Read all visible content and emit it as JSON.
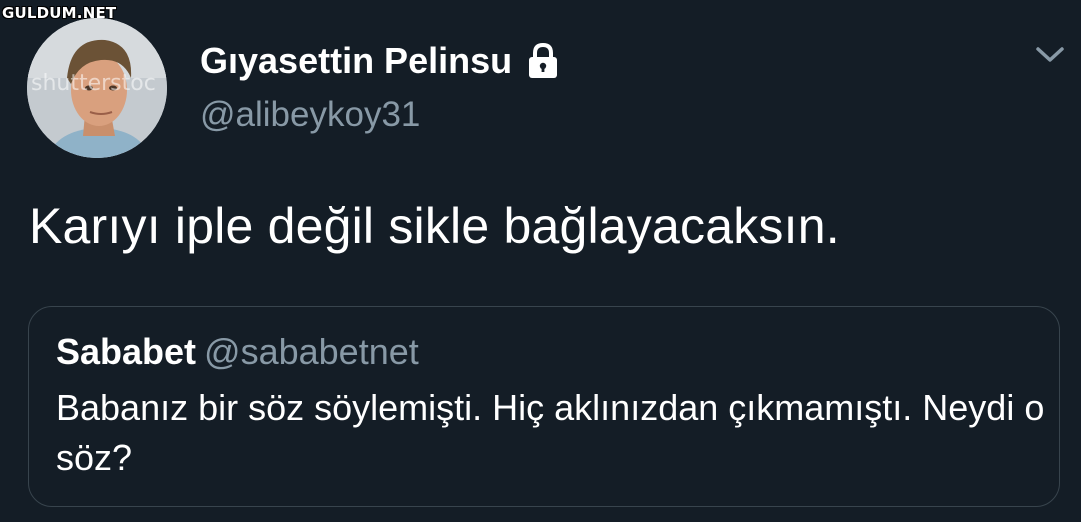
{
  "watermark": "GULDUM.NET",
  "tweet": {
    "author_name": "Gıyasettin Pelinsu",
    "author_handle": "@alibeykoy31",
    "text": "Karıyı iple değil sikle bağlayacaksın.",
    "avatar_watermark": "shutterstoc",
    "icons": {
      "lock": "lock-icon",
      "menu": "chevron-down-icon"
    }
  },
  "quoted": {
    "author_name": "Sababet",
    "author_handle": "@sababetnet",
    "text": "Babanız bir söz söylemişti. Hiç aklınızdan çıkmamıştı. Neydi o söz?"
  },
  "colors": {
    "background": "#141d26",
    "secondary_text": "#8899a6",
    "border": "#38444d"
  }
}
